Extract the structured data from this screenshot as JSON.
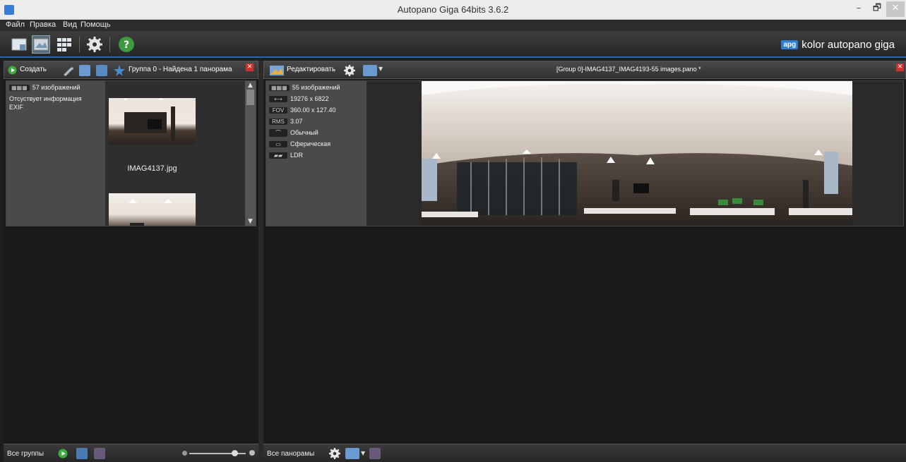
{
  "window": {
    "title": "Autopano Giga 64bits 3.6.2",
    "minimize": "–",
    "maximize": "🗗",
    "close": "✕"
  },
  "menu": [
    "Файл",
    "Правка",
    "Вид",
    "Помощь"
  ],
  "brand": {
    "badge": "apg",
    "text": "kolor autopano giga"
  },
  "left_panel": {
    "create_label": "Создать",
    "group_status": "Группа 0 - Найдена 1 панорама",
    "group": {
      "image_count": "57 изображений",
      "exif_line1": "Отсуствует информация",
      "exif_line2": "EXIF",
      "thumbnail_caption": "IMAG4137.jpg"
    },
    "footer_label": "Все группы",
    "zoom_level": 0.8
  },
  "right_panel": {
    "edit_label": "Редактировать",
    "pano_title": "[Group 0]-IMAG4137_IMAG4193-55 images.pano *",
    "info": [
      {
        "badge": "",
        "value": "55 изображений"
      },
      {
        "badge": "",
        "value": "19276 x 6822"
      },
      {
        "badge": "FOV",
        "value": "360.00 x 127.40"
      },
      {
        "badge": "RMS",
        "value": "3.07"
      },
      {
        "badge": "",
        "value": "Обычный"
      },
      {
        "badge": "",
        "value": "Сферическая"
      },
      {
        "badge": "",
        "value": "LDR"
      }
    ],
    "footer_label": "Все панорамы"
  },
  "colors": {
    "accent": "#2b66a8",
    "close_red": "#d03030",
    "brand_blue": "#2f7fd4"
  }
}
